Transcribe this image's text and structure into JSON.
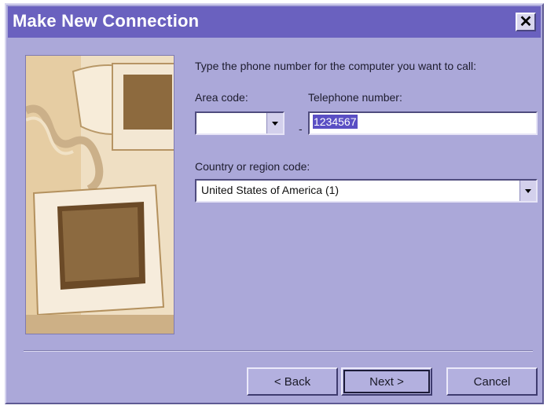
{
  "window": {
    "title": "Make New Connection"
  },
  "prompt": "Type the phone number for the computer you want to call:",
  "area_code": {
    "label": "Area code:",
    "value": ""
  },
  "separator_dash": "-",
  "telephone": {
    "label": "Telephone number:",
    "value": "1234567"
  },
  "country": {
    "label": "Country or region code:",
    "value": "United States of America (1)"
  },
  "buttons": {
    "back": "< Back",
    "next": "Next >",
    "cancel": "Cancel"
  },
  "icons": {
    "close": "close-icon",
    "dropdown": "chevron-down-icon"
  }
}
